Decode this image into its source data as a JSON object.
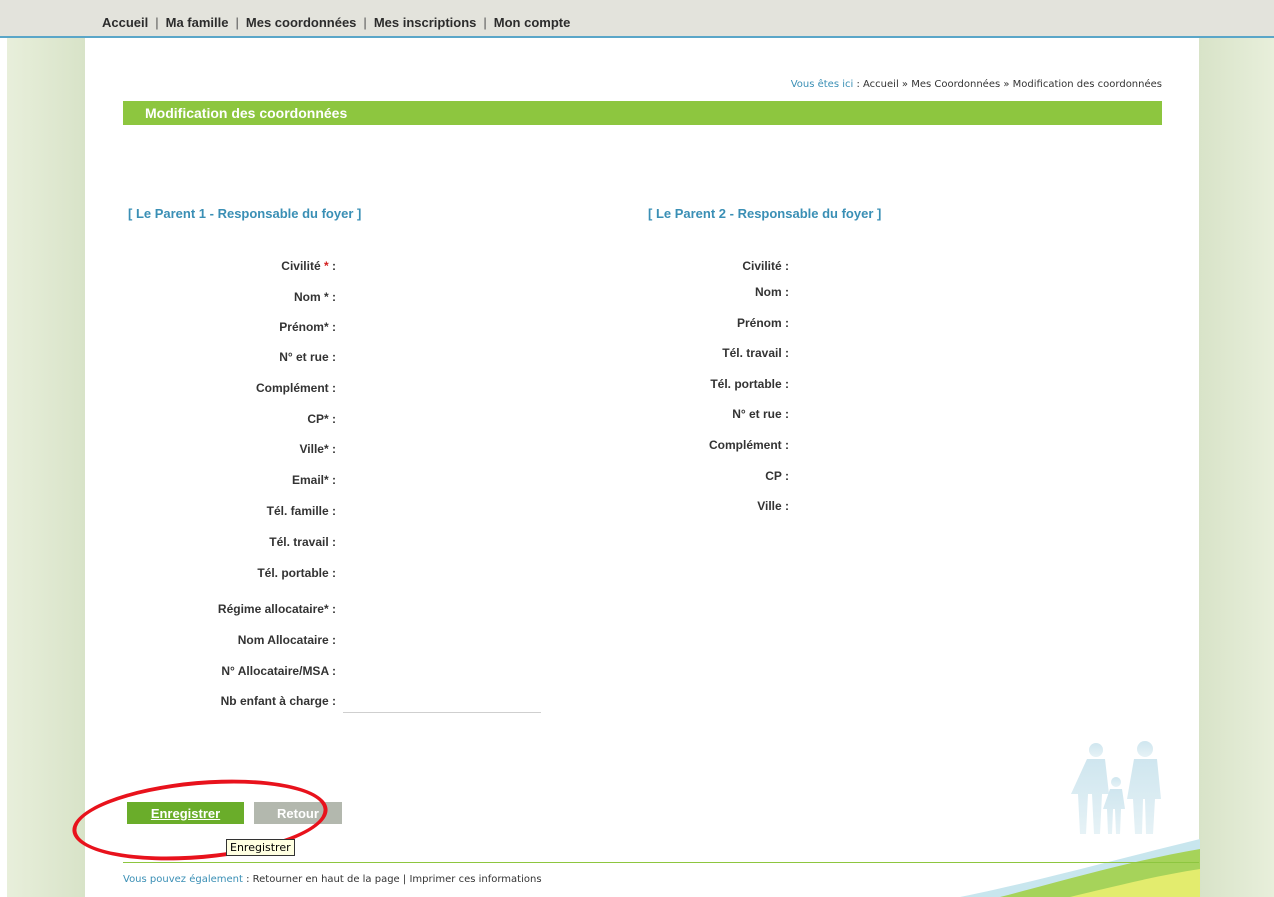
{
  "topnav": {
    "items": [
      "Accueil",
      "Ma famille",
      "Mes coordonnées",
      "Mes inscriptions",
      "Mon compte"
    ],
    "separator": "|"
  },
  "breadcrumb": {
    "prefix": "Vous êtes ici",
    "colon": " : ",
    "trail": "Accueil » Mes Coordonnées » Modification des coordonnées"
  },
  "page_title": "Modification des coordonnées",
  "parent1": {
    "heading": "[ Le Parent 1 - Responsable du foyer ]",
    "fields": {
      "civilite": "Civilité",
      "nom": "Nom",
      "prenom": "Prénom",
      "rue": "N° et rue :",
      "complement": "Complément :",
      "cp": "CP",
      "ville": "Ville",
      "email": "Email",
      "tel_famille": "Tél. famille :",
      "tel_travail": "Tél. travail :",
      "tel_portable": "Tél. portable :",
      "regime": "Régime allocataire",
      "nom_alloc": "Nom Allocataire :",
      "num_alloc": "N° Allocataire/MSA :",
      "nb_enfant": "Nb enfant à charge :"
    },
    "nb_enfant_value": ""
  },
  "parent2": {
    "heading": "[ Le Parent 2 - Responsable du foyer ]",
    "fields": {
      "civilite": "Civilité :",
      "nom": "Nom :",
      "prenom": "Prénom :",
      "tel_travail": "Tél. travail :",
      "tel_portable": "Tél. portable :",
      "rue": "N° et rue :",
      "complement": "Complément :",
      "cp": "CP :",
      "ville": "Ville :"
    }
  },
  "required_marker": "*",
  "label_suffix": " :",
  "buttons": {
    "save": "Enregistrer",
    "back": "Retour"
  },
  "tooltip": "Enregistrer",
  "footer": {
    "lead": "Vous pouvez également",
    "colon": " : ",
    "link_top": "Retourner en haut de la page",
    "divider": " | ",
    "link_print": "Imprimer ces informations"
  },
  "colors": {
    "accent_green": "#8dc63f",
    "button_green": "#6aad2a",
    "link_blue": "#3a8fb5",
    "highlight_red": "#e8121c"
  }
}
